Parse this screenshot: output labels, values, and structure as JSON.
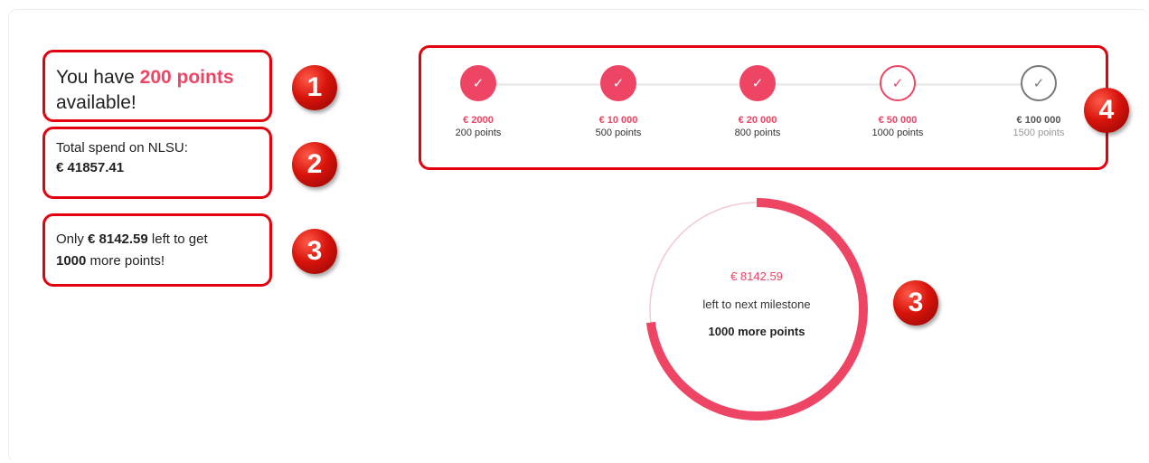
{
  "colors": {
    "accent": "#ef4565",
    "annotation": "#e3000f",
    "future": "#777777"
  },
  "points_available": {
    "prefix": "You have",
    "points": "200 points",
    "suffix": "available!"
  },
  "total_spend": {
    "label": "Total spend on NLSU:",
    "value": "€ 41857.41"
  },
  "remaining": {
    "prefix": "Only",
    "amount": "€ 8142.59",
    "middle": "left to get",
    "points": "1000",
    "suffix": "more points!"
  },
  "milestones": [
    {
      "amount": "€ 2000",
      "points": "200 points",
      "status": "done",
      "icon": "check-icon",
      "glyph": "✓"
    },
    {
      "amount": "€ 10 000",
      "points": "500 points",
      "status": "done",
      "icon": "check-icon",
      "glyph": "✓"
    },
    {
      "amount": "€ 20 000",
      "points": "800 points",
      "status": "done",
      "icon": "check-icon",
      "glyph": "✓"
    },
    {
      "amount": "€ 50 000",
      "points": "1000 points",
      "status": "current",
      "icon": "check-icon",
      "glyph": "✓"
    },
    {
      "amount": "€ 100 000",
      "points": "1500 points",
      "status": "future",
      "icon": "check-icon",
      "glyph": "✓"
    }
  ],
  "progress_ring": {
    "amount": "€ 8142.59",
    "label": "left to next milestone",
    "points": "1000 more points",
    "progress_fraction": 0.73
  },
  "annotations": [
    "1",
    "2",
    "3",
    "3",
    "4"
  ]
}
